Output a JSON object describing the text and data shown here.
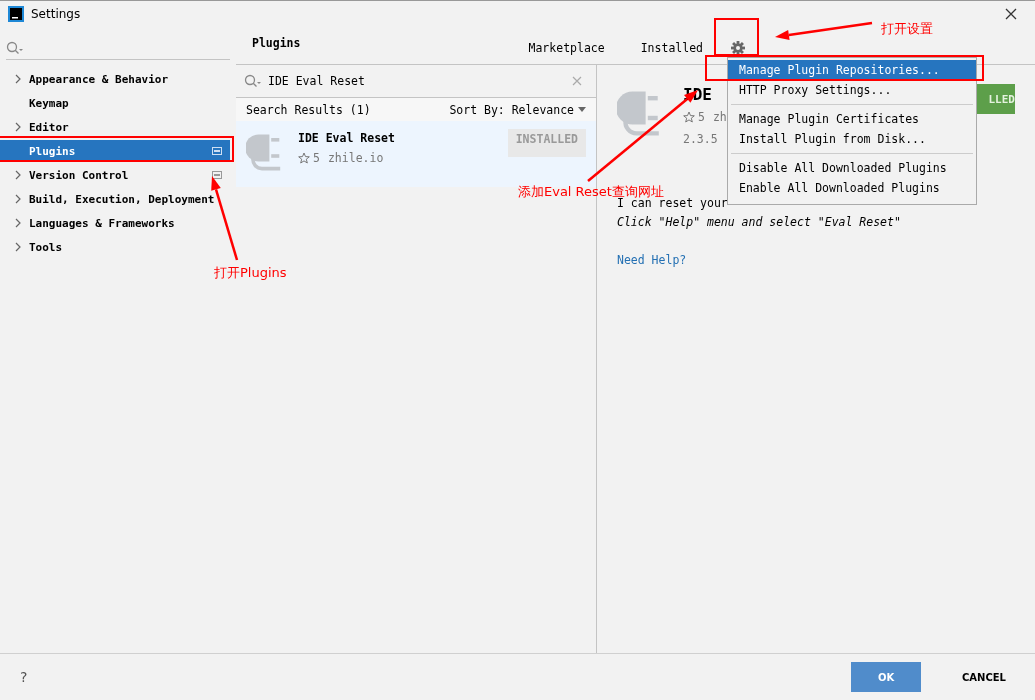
{
  "window": {
    "title": "Settings"
  },
  "sidebar": {
    "items": [
      {
        "label": "Appearance & Behavior",
        "expandable": true,
        "selected": false,
        "badge": false
      },
      {
        "label": "Keymap",
        "expandable": false,
        "selected": false,
        "badge": false
      },
      {
        "label": "Editor",
        "expandable": true,
        "selected": false,
        "badge": false
      },
      {
        "label": "Plugins",
        "expandable": false,
        "selected": true,
        "badge": true
      },
      {
        "label": "Version Control",
        "expandable": true,
        "selected": false,
        "badge": true
      },
      {
        "label": "Build, Execution, Deployment",
        "expandable": true,
        "selected": false,
        "badge": false
      },
      {
        "label": "Languages & Frameworks",
        "expandable": true,
        "selected": false,
        "badge": false
      },
      {
        "label": "Tools",
        "expandable": true,
        "selected": false,
        "badge": false
      }
    ]
  },
  "header": {
    "title": "Plugins",
    "tabs": [
      {
        "label": "Marketplace",
        "selected": false
      },
      {
        "label": "Installed",
        "selected": false
      }
    ]
  },
  "search": {
    "value": "IDE Eval Reset"
  },
  "results": {
    "heading": "Search Results (1)",
    "sort": "Sort By: Relevance",
    "items": [
      {
        "name": "IDE Eval Reset",
        "rating": "5",
        "vendor": "zhile.io",
        "status": "INSTALLED",
        "selected": true
      }
    ]
  },
  "details": {
    "title": "IDE",
    "rating": "5",
    "vendor": "zh",
    "version": "2.3.5",
    "button": "LLED",
    "description": "I can reset your",
    "hint": "Click \"Help\" menu and select \"Eval Reset\"",
    "link": "Need Help?"
  },
  "menu": {
    "groups": [
      [
        {
          "label": "Manage Plugin Repositories...",
          "selected": true
        },
        {
          "label": "HTTP Proxy Settings...",
          "selected": false
        }
      ],
      [
        {
          "label": "Manage Plugin Certificates",
          "selected": false
        },
        {
          "label": "Install Plugin from Disk...",
          "selected": false
        }
      ],
      [
        {
          "label": "Disable All Downloaded Plugins",
          "selected": false
        },
        {
          "label": "Enable All Downloaded Plugins",
          "selected": false
        }
      ]
    ]
  },
  "footer": {
    "help": "?",
    "buttons": [
      {
        "label": "OK",
        "primary": true
      },
      {
        "label": "CANCEL",
        "primary": false
      }
    ]
  },
  "annotations": [
    {
      "text": "打开Plugins"
    },
    {
      "text": "添加Eval Reset查询网址"
    },
    {
      "text": "打开设置"
    }
  ]
}
